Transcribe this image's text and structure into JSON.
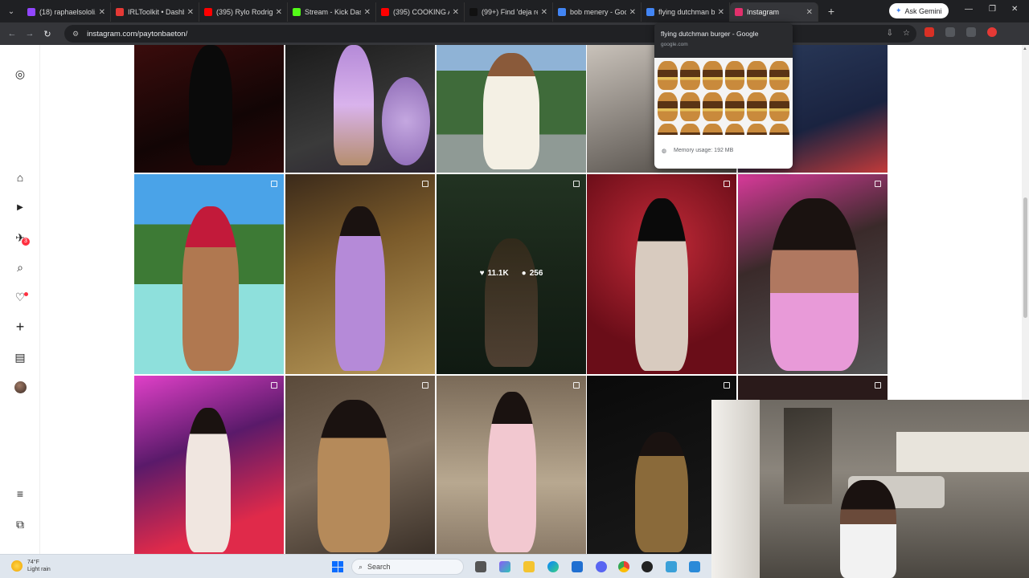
{
  "browser": {
    "tabs": [
      {
        "label": "(18) raphaelsololi..",
        "color": "#9146ff"
      },
      {
        "label": "IRLToolkit • Dashb..",
        "color": "#e53935"
      },
      {
        "label": "(395) Rylo Rodrigu..",
        "color": "#ff0000"
      },
      {
        "label": "Stream - Kick Dash..",
        "color": "#53fc18"
      },
      {
        "label": "(395) COOKING A..",
        "color": "#ff0000"
      },
      {
        "label": "(99+) Find 'deja re..",
        "color": "#111111"
      },
      {
        "label": "bob menery - Goo..",
        "color": "#4285f4"
      },
      {
        "label": "flying dutchman b..",
        "color": "#4285f4"
      },
      {
        "label": "Instagram",
        "color": "#e1306c",
        "active": true
      }
    ],
    "new_tab_glyph": "+",
    "ask_gemini_label": "Ask Gemini",
    "url": "instagram.com/paytonbaeton/"
  },
  "hover_card": {
    "title": "flying dutchman burger - Google",
    "subtitle": "google.com",
    "memory_usage": "Memory usage: 192 MB"
  },
  "sidebar": {
    "items": [
      {
        "name": "instagram-logo-icon",
        "glyph": "◎"
      },
      {
        "name": "home-icon",
        "glyph": "⌂"
      },
      {
        "name": "reels-icon",
        "glyph": "▶"
      },
      {
        "name": "messages-icon",
        "glyph": "✈",
        "badge": "3"
      },
      {
        "name": "search-icon",
        "glyph": "⌕"
      },
      {
        "name": "notifications-icon",
        "glyph": "♡",
        "dot": true
      },
      {
        "name": "create-icon",
        "glyph": "+"
      },
      {
        "name": "dashboard-icon",
        "glyph": "▤"
      },
      {
        "name": "profile-avatar",
        "glyph": ""
      },
      {
        "name": "more-menu-icon",
        "glyph": "≡"
      },
      {
        "name": "also-from-meta-icon",
        "glyph": "⧉"
      }
    ]
  },
  "posts": {
    "hovered_post_likes": "11.1K",
    "hovered_post_comments": "256"
  },
  "taskbar": {
    "weather_temp": "74°F",
    "weather_desc": "Light rain",
    "search_placeholder": "Search"
  },
  "colors": {
    "chrome_dark": "#1f2023",
    "toolbar": "#35363a",
    "badge_red": "#ff3040"
  }
}
